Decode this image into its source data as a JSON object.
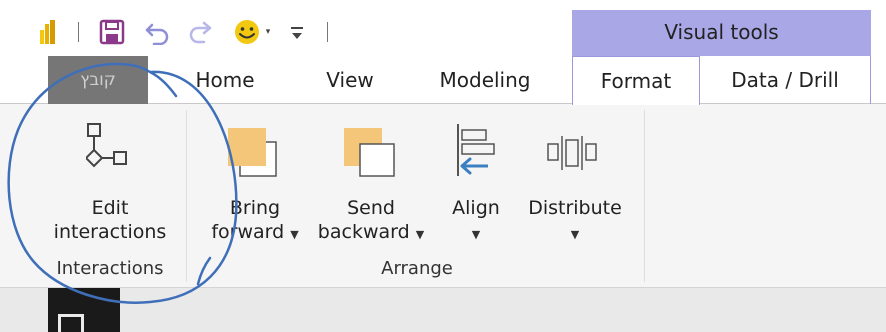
{
  "quick_access": {
    "icons": [
      "power-bi-logo-icon",
      "save-icon",
      "undo-icon",
      "redo-icon",
      "smiley-feedback-icon",
      "customize-toolbar-icon"
    ]
  },
  "contextual_group": {
    "label": "Visual tools"
  },
  "tabs": [
    {
      "id": "file",
      "label": "קובץ"
    },
    {
      "id": "home",
      "label": "Home"
    },
    {
      "id": "view",
      "label": "View"
    },
    {
      "id": "modeling",
      "label": "Modeling"
    },
    {
      "id": "format",
      "label": "Format",
      "active": true
    },
    {
      "id": "data_drill",
      "label": "Data / Drill"
    }
  ],
  "ribbon": {
    "interactions_group": {
      "label": "Interactions",
      "edit_interactions": {
        "line1": "Edit",
        "line2": "interactions"
      }
    },
    "arrange_group": {
      "label": "Arrange",
      "bring_forward": {
        "line1": "Bring",
        "line2": "forward"
      },
      "send_backward": {
        "line1": "Send",
        "line2": "backward"
      },
      "align": {
        "line1": "Align"
      },
      "distribute": {
        "line1": "Distribute"
      }
    }
  },
  "colors": {
    "contextual_accent": "#a9a7e6",
    "file_tab": "#767676",
    "icon_fill_orange": "#f3c67a",
    "annotation_stroke": "#3f6fb9"
  }
}
